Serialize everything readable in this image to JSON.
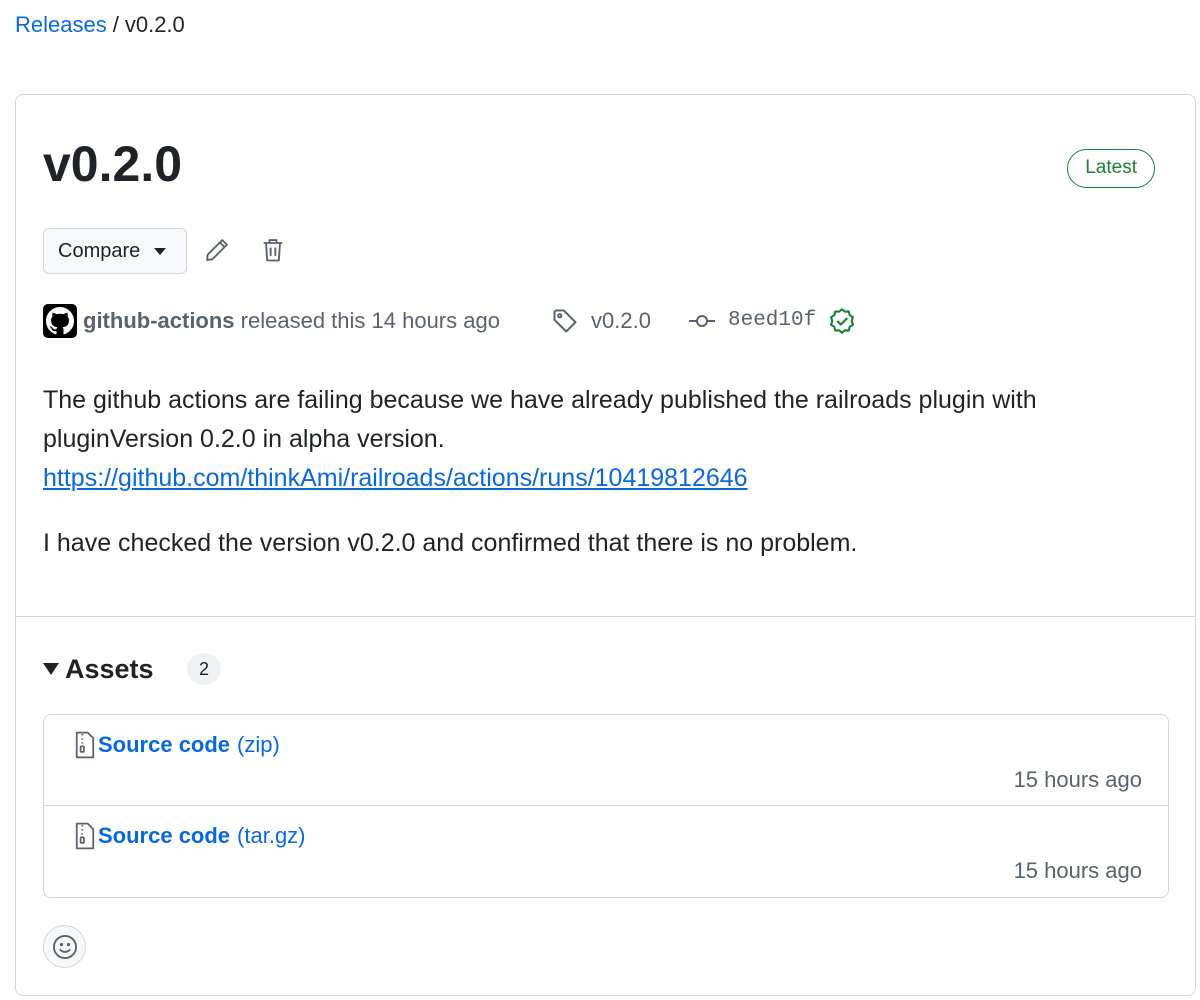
{
  "breadcrumb": {
    "parent": "Releases",
    "separator": "/",
    "current": "v0.2.0"
  },
  "release": {
    "title": "v0.2.0",
    "badge": "Latest",
    "compare_label": "Compare",
    "author": "github-actions",
    "released_text": "released this 14 hours ago",
    "tag": "v0.2.0",
    "commit": "8eed10f",
    "body": {
      "paragraph1": "The github actions are failing because we have already published the railroads plugin with pluginVersion 0.2.0 in alpha version.",
      "link": "https://github.com/thinkAmi/railroads/actions/runs/10419812646",
      "paragraph2": "I have checked the version v0.2.0 and confirmed that there is no problem."
    }
  },
  "assets": {
    "label": "Assets",
    "count": "2",
    "items": [
      {
        "name": "Source code",
        "ext": "(zip)",
        "time": "15 hours ago",
        "icon": "file-zip-icon"
      },
      {
        "name": "Source code",
        "ext": "(tar.gz)",
        "time": "15 hours ago",
        "icon": "file-zip-icon"
      }
    ]
  },
  "colors": {
    "link": "#0969da",
    "success": "#1a7f37",
    "muted": "#59636e",
    "border": "#d0d7de"
  }
}
